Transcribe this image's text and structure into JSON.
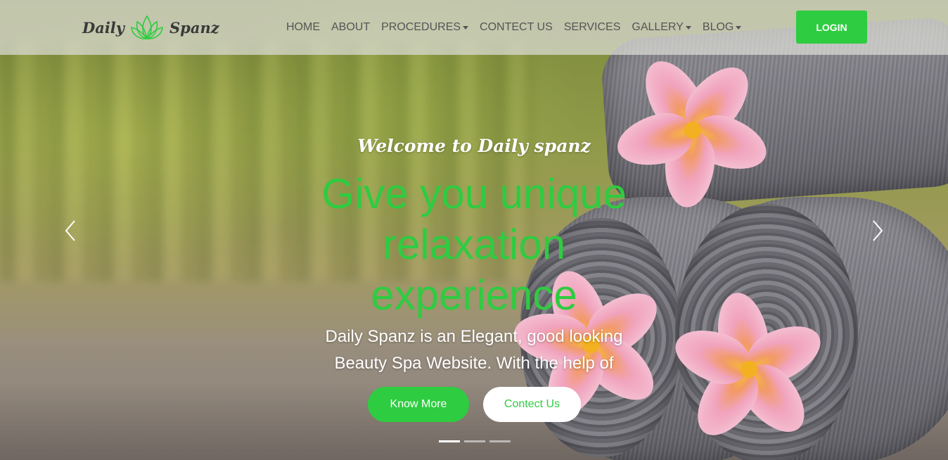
{
  "brand": {
    "name_left": "Daily",
    "name_right": "Spanz",
    "logo_icon": "lotus-icon"
  },
  "nav": {
    "items": [
      {
        "label": "HOME",
        "dropdown": false
      },
      {
        "label": "ABOUT",
        "dropdown": false
      },
      {
        "label": "PROCEDURES",
        "dropdown": true
      },
      {
        "label": "CONTECT US",
        "dropdown": false
      },
      {
        "label": "SERVICES",
        "dropdown": false
      },
      {
        "label": "GALLERY",
        "dropdown": true
      },
      {
        "label": "BLOG",
        "dropdown": true
      }
    ],
    "login_label": "LOGIN"
  },
  "hero": {
    "welcome": "Welcome to Daily spanz",
    "headline": "Give you unique relaxation experience",
    "tagline": "Daily Spanz is an Elegant, good looking Beauty Spa Website. With the help of",
    "primary_button": "Know More",
    "secondary_button": "Contect Us",
    "prev_icon": "chevron-left-icon",
    "next_icon": "chevron-right-icon",
    "slides": 3,
    "active_slide": 1
  },
  "colors": {
    "accent": "#2ecc40",
    "nav_text": "#555555",
    "white": "#ffffff"
  }
}
